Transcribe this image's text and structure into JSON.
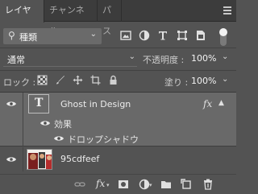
{
  "tabs": [
    {
      "label": "レイヤー",
      "active": true
    },
    {
      "label": "チャンネル",
      "active": false
    },
    {
      "label": "パス",
      "active": false
    }
  ],
  "filter": {
    "kind_label": "種類",
    "icons": [
      "image-filter-icon",
      "adjustment-filter-icon",
      "type-filter-icon",
      "shape-filter-icon",
      "smart-object-filter-icon"
    ],
    "toggle": "filter-toggle"
  },
  "blend": {
    "mode": "通常",
    "opacity_label": "不透明度 :",
    "opacity_value": "100%"
  },
  "lock": {
    "label": "ロック :",
    "icons": [
      "lock-transparent-pixels-icon",
      "lock-image-pixels-icon",
      "lock-position-icon",
      "lock-artboard-icon",
      "lock-all-icon"
    ],
    "fill_label": "塗り :",
    "fill_value": "100%"
  },
  "layers": [
    {
      "name": "Ghost in Design",
      "type": "text",
      "visible": true,
      "selected": true,
      "fx_badge": "fx",
      "effects_label": "効果",
      "effects": [
        "ドロップシャドウ"
      ]
    },
    {
      "name": "95cdfeef",
      "type": "image",
      "visible": true,
      "selected": false
    }
  ],
  "footer": {
    "fx_label": "fx",
    "icons": [
      "link-layers-icon",
      "layer-style-icon",
      "add-mask-icon",
      "adjustment-layer-icon",
      "new-group-icon",
      "new-layer-icon",
      "delete-layer-icon"
    ]
  },
  "colors": {
    "panel_bg": "#535353",
    "tabbar_bg": "#3c3c3c",
    "selected_row": "#696969"
  }
}
